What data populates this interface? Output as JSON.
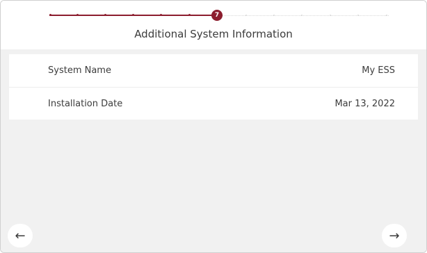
{
  "stepper": {
    "current_step": "7",
    "total_steps": 14,
    "completed_steps": 6
  },
  "header": {
    "title": "Additional System Information"
  },
  "rows": [
    {
      "label": "System Name",
      "value": "My ESS"
    },
    {
      "label": "Installation Date",
      "value": "Mar 13, 2022"
    }
  ],
  "nav": {
    "back_icon": "←",
    "next_icon": "→"
  },
  "colors": {
    "accent": "#8c1d2e",
    "panel": "#f1f1f1"
  }
}
